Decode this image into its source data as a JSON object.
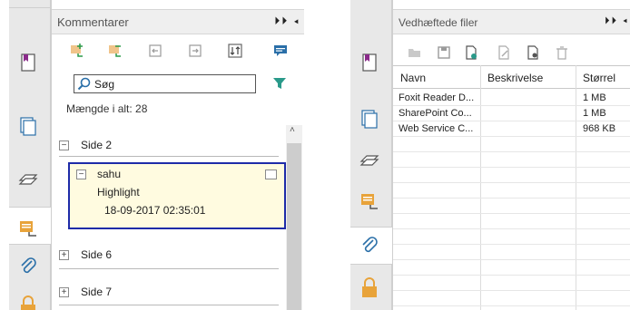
{
  "left_panel": {
    "title": "Kommentarer",
    "title_buttons": "⏵⏵ ◂",
    "search_label": "Søg",
    "count_text": "Mængde i alt: 28",
    "groups": [
      {
        "label": "Side 2",
        "toggle": "−"
      },
      {
        "label": "Side 6",
        "toggle": "+"
      },
      {
        "label": "Side 7",
        "toggle": "+"
      }
    ],
    "selected_comment": {
      "toggle": "−",
      "author": "sahu",
      "type": "Highlight",
      "date": "18-09-2017 02:35:01"
    },
    "rail_icons": [
      "bookmark-icon",
      "pages-icon",
      "layers-icon",
      "comments-icon",
      "attachment-icon",
      "lock-icon"
    ],
    "toolbar_icons": [
      "add-comment-icon",
      "remove-comment-icon",
      "import-icon",
      "export-icon",
      "sort-icon",
      "comment-bubble-icon"
    ]
  },
  "right_panel": {
    "title": "Vedhæftede filer",
    "title_buttons": "⏵⏵ ◂",
    "columns": [
      "Navn",
      "Beskrivelse",
      "Størrel"
    ],
    "files": [
      {
        "name": "Foxit Reader D...",
        "description": "",
        "size": "1 MB"
      },
      {
        "name": "SharePoint Co...",
        "description": "",
        "size": "1 MB"
      },
      {
        "name": "Web Service C...",
        "description": "",
        "size": "968 KB"
      }
    ],
    "toolbar_icons": [
      "open-folder-icon",
      "save-icon",
      "add-file-icon",
      "edit-icon",
      "properties-icon",
      "delete-icon"
    ]
  },
  "colors": {
    "accent_blue": "#1e2ba8",
    "highlight_bg": "#fffbe0",
    "icon_orange": "#e8a33a",
    "icon_teal": "#2a9a8a"
  }
}
